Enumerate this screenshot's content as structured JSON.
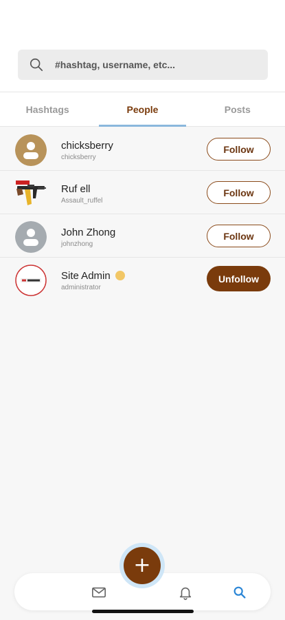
{
  "search": {
    "placeholder": "#hashtag, username, etc...",
    "value": ""
  },
  "tabs": [
    {
      "label": "Hashtags",
      "active": false
    },
    {
      "label": "People",
      "active": true
    },
    {
      "label": "Posts",
      "active": false
    }
  ],
  "people": [
    {
      "name": "chicksberry",
      "handle": "chicksberry",
      "button": "Follow",
      "avatar": "default-avatar-icon"
    },
    {
      "name": "Ruf ell",
      "handle": "Assault_ruffel",
      "button": "Follow",
      "avatar": "rifle-image"
    },
    {
      "name": "John Zhong",
      "handle": "johnzhong",
      "button": "Follow",
      "avatar": "default-avatar-icon"
    },
    {
      "name": "Site Admin",
      "handle": "administrator",
      "button": "Unfollow",
      "avatar": "logo-image",
      "verified": true
    }
  ],
  "bottom_nav": {
    "items": [
      "mail-icon",
      "bell-icon",
      "search-icon"
    ],
    "fab": "+"
  },
  "colors": {
    "accent": "#7a3b0c",
    "tab_indicator": "#8ab7dc",
    "avatar_gold": "#b8935a",
    "avatar_gray": "#a5abb0"
  }
}
